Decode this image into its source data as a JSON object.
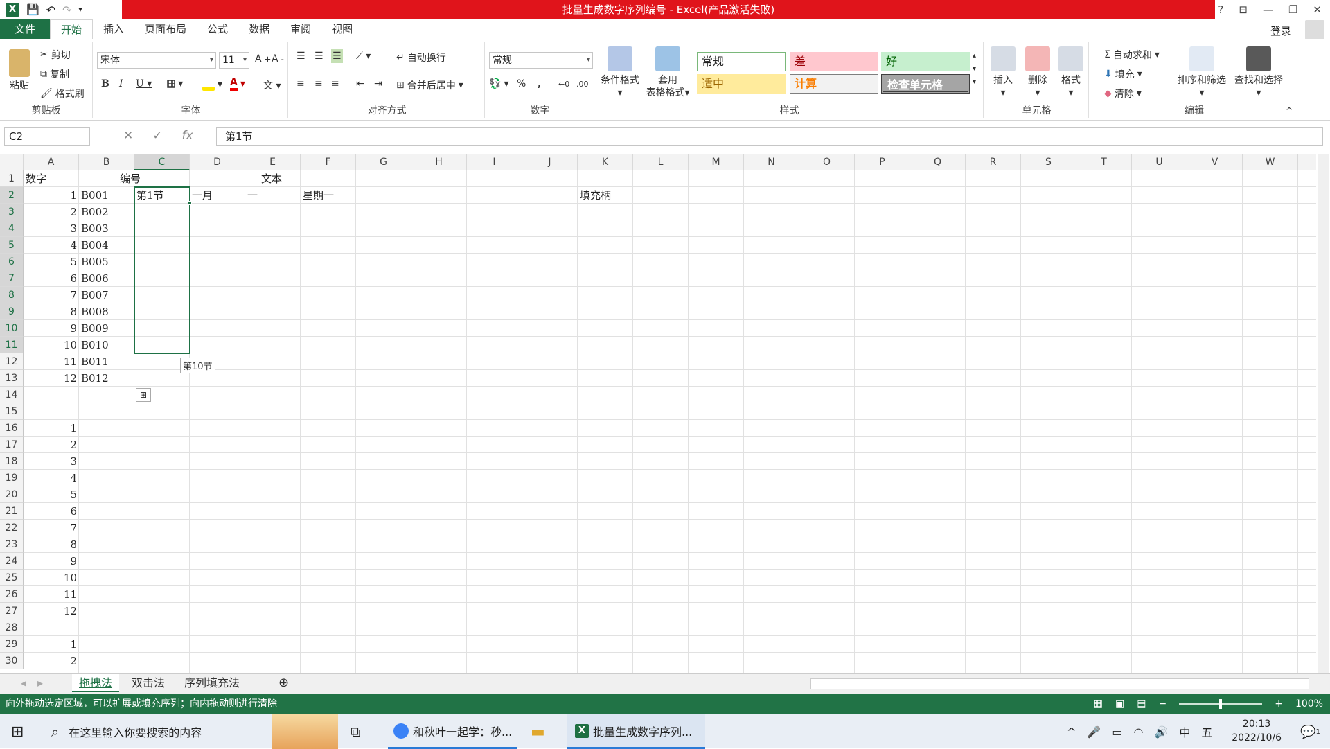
{
  "window": {
    "title": "批量生成数字序列编号 - Excel(产品激活失败)",
    "help": "?",
    "controls": [
      "?",
      "□",
      "—",
      "❐",
      "✕"
    ]
  },
  "tabs": [
    "文件",
    "开始",
    "插入",
    "页面布局",
    "公式",
    "数据",
    "审阅",
    "视图"
  ],
  "active_tab": "开始",
  "login": "登录",
  "ribbon": {
    "clipboard": {
      "label": "剪贴板",
      "paste": "粘贴",
      "cut": "剪切",
      "copy": "复制",
      "format_painter": "格式刷"
    },
    "font": {
      "label": "字体",
      "name": "宋体",
      "size": "11"
    },
    "alignment": {
      "label": "对齐方式",
      "wrap": "自动换行",
      "merge": "合并后居中"
    },
    "number": {
      "label": "数字",
      "format": "常规",
      "percent": "%",
      "comma": ","
    },
    "styles": {
      "label": "样式",
      "conditional": "条件格式",
      "table_format": [
        "套用",
        "表格格式"
      ],
      "boxes": [
        {
          "text": "常规",
          "bg": "#ffffff",
          "color": "#222222",
          "border": "#7ab87a"
        },
        {
          "text": "差",
          "bg": "#ffc7ce",
          "color": "#9c0006",
          "border": "#ffc7ce"
        },
        {
          "text": "好",
          "bg": "#c6efce",
          "color": "#006100",
          "border": "#c6efce"
        },
        {
          "text": "适中",
          "bg": "#ffeb9c",
          "color": "#9c6500",
          "border": "#ffeb9c"
        },
        {
          "text": "计算",
          "bg": "#f2f2f2",
          "color": "#fa7d00",
          "border": "#7f7f7f"
        },
        {
          "text": "检查单元格",
          "bg": "#a5a5a5",
          "color": "#ffffff",
          "border": "#3f3f3f"
        }
      ]
    },
    "cells": {
      "label": "单元格",
      "insert": "插入",
      "delete": "删除",
      "format": "格式"
    },
    "editing": {
      "label": "编辑",
      "autosum": "自动求和",
      "fill": "填充",
      "clear": "清除",
      "sort": "排序和筛选",
      "find": "查找和选择"
    }
  },
  "formula_bar": {
    "name_box": "C2",
    "formula": "第1节"
  },
  "columns": [
    "A",
    "B",
    "C",
    "D",
    "E",
    "F",
    "G",
    "H",
    "I",
    "J",
    "K",
    "L",
    "M",
    "N",
    "O",
    "P",
    "Q",
    "R",
    "S",
    "T",
    "U",
    "V",
    "W"
  ],
  "selected_column": "C",
  "rows": [
    "1",
    "2",
    "3",
    "4",
    "5",
    "6",
    "7",
    "8",
    "9",
    "10",
    "11",
    "12",
    "13",
    "14",
    "15",
    "16",
    "17",
    "18",
    "19",
    "20",
    "21",
    "22",
    "23",
    "24",
    "25",
    "26",
    "27",
    "28",
    "29",
    "30"
  ],
  "selected_rows": [
    "2",
    "3",
    "4",
    "5",
    "6",
    "7",
    "8",
    "9",
    "10",
    "11"
  ],
  "cell_values": {
    "A1": "数字",
    "B1": "编号",
    "E1": "文本",
    "A2": "1",
    "B2": "B001",
    "C2": "第1节",
    "D2": "一月",
    "E2": "一",
    "F2": "星期一",
    "K2": "填充柄",
    "A3": "2",
    "B3": "B002",
    "A4": "3",
    "B4": "B003",
    "A5": "4",
    "B5": "B004",
    "A6": "5",
    "B6": "B005",
    "A7": "6",
    "B7": "B006",
    "A8": "7",
    "B8": "B007",
    "A9": "8",
    "B9": "B008",
    "A10": "9",
    "B10": "B009",
    "A11": "10",
    "B11": "B010",
    "A12": "11",
    "B12": "B011",
    "A13": "12",
    "B13": "B012",
    "A16": "1",
    "A17": "2",
    "A18": "3",
    "A19": "4",
    "A20": "5",
    "A21": "6",
    "A22": "7",
    "A23": "8",
    "A24": "9",
    "A25": "10",
    "A26": "11",
    "A27": "12",
    "A29": "1",
    "A30": "2"
  },
  "fill_tooltip": "第10节",
  "sheet_tabs": [
    "拖拽法",
    "双击法",
    "序列填充法"
  ],
  "active_sheet": "拖拽法",
  "status_bar": {
    "message": "向外拖动选定区域，可以扩展或填充序列；向内拖动则进行清除",
    "zoom": "100%"
  },
  "taskbar": {
    "search_placeholder": "在这里输入你要搜索的内容",
    "apps": [
      "和秋叶一起学：秒...",
      "批量生成数字序列..."
    ],
    "ime": "中",
    "ime2": "五",
    "time": "20:13",
    "date": "2022/10/6",
    "notifications": "1"
  }
}
